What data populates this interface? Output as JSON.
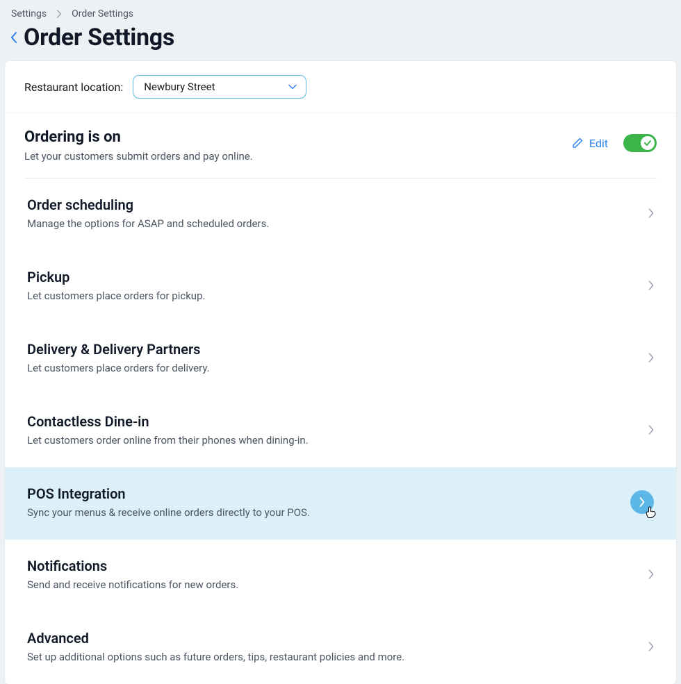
{
  "breadcrumb": {
    "items": [
      "Settings",
      "Order Settings"
    ]
  },
  "page": {
    "title": "Order Settings"
  },
  "location": {
    "label": "Restaurant location:",
    "selected": "Newbury Street"
  },
  "ordering": {
    "title": "Ordering is on",
    "description": "Let your customers submit orders and pay online.",
    "edit_label": "Edit",
    "toggle_on": true
  },
  "rows": [
    {
      "title": "Order scheduling",
      "desc": "Manage the options for ASAP and scheduled orders."
    },
    {
      "title": "Pickup",
      "desc": "Let customers place orders for pickup."
    },
    {
      "title": "Delivery & Delivery Partners",
      "desc": "Let customers place orders for delivery."
    },
    {
      "title": "Contactless Dine-in",
      "desc": "Let customers order online from their phones when dining-in."
    },
    {
      "title": "POS Integration",
      "desc": "Sync your menus & receive online orders directly to your POS."
    },
    {
      "title": "Notifications",
      "desc": "Send and receive notifications for new orders."
    },
    {
      "title": "Advanced",
      "desc": "Set up additional options such as future orders, tips, restaurant policies and more."
    }
  ]
}
